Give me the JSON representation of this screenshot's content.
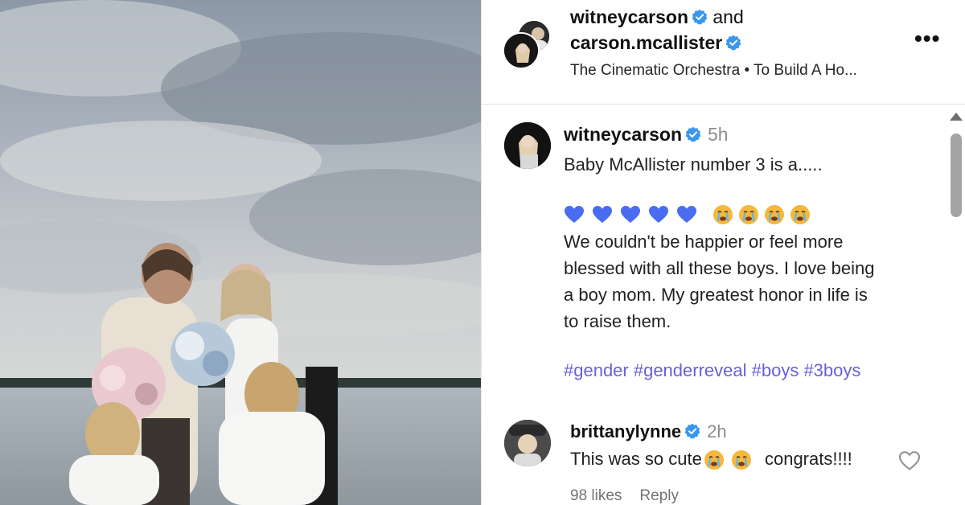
{
  "header": {
    "user1": "witneycarson",
    "joiner": "and",
    "user2": "carson.mcallister",
    "audio": "The Cinematic Orchestra • To Build A Ho...",
    "more_label": "•••"
  },
  "post": {
    "author": "witneycarson",
    "time": "5h",
    "title_line": "Baby McAllister number 3 is a.....",
    "emojis": {
      "hearts": [
        "blue-heart",
        "blue-heart",
        "blue-heart",
        "blue-heart",
        "blue-heart"
      ],
      "faces": [
        "crying-face",
        "crying-face",
        "crying-face",
        "crying-face"
      ]
    },
    "body": "We couldn't be happier or feel more\nblessed with all these boys. I love being\na boy mom. My greatest honor in life is\nto raise them.",
    "hashtags": "#gender #genderreveal #boys #3boys"
  },
  "comment": {
    "author": "brittanylynne",
    "time": "2h",
    "text_a": "This was so cute",
    "text_b": "congrats!!!!",
    "likes": "98 likes",
    "reply": "Reply"
  },
  "colors": {
    "verified": "#3897f0",
    "hashtag": "#6a5fd6",
    "heart_emoji": "#4a6cf0"
  }
}
